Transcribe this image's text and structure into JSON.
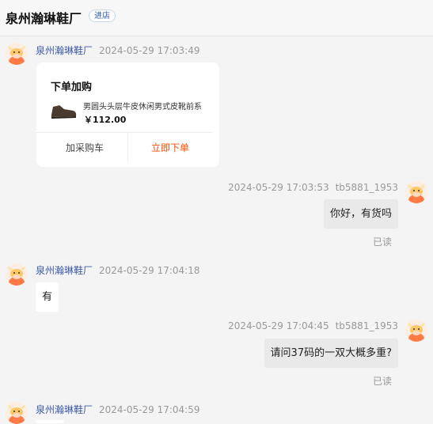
{
  "header": {
    "shop_name": "泉州瀚琳鞋厂",
    "enter_label": "进店"
  },
  "messages": [
    {
      "side": "left",
      "nickname": "泉州瀚琳鞋厂",
      "time": "2024-05-29 17:03:49"
    },
    {
      "side": "right",
      "nickname": "tb5881_1953",
      "time": "2024-05-29 17:03:53",
      "text": "你好，有货吗",
      "status": "已读"
    },
    {
      "side": "left",
      "nickname": "泉州瀚琳鞋厂",
      "time": "2024-05-29 17:04:18",
      "text": "有"
    },
    {
      "side": "right",
      "nickname": "tb5881_1953",
      "time": "2024-05-29 17:04:45",
      "text": "请问37码的一双大概多重?",
      "status": "已读"
    },
    {
      "side": "left",
      "nickname": "泉州瀚琳鞋厂",
      "time": "2024-05-29 17:04:59"
    }
  ],
  "product_card": {
    "title": "下单加购",
    "product_name": "男圆头头层牛皮休闲男式皮靴前系",
    "price": "￥112.00",
    "add_cart_label": "加采购车",
    "order_label": "立即下单",
    "order_color": "#ff4d00"
  },
  "colors": {
    "seller_name": "#3c5aa8",
    "buyer_bubble": "#e9e9e9",
    "background": "#f4f4f4"
  }
}
